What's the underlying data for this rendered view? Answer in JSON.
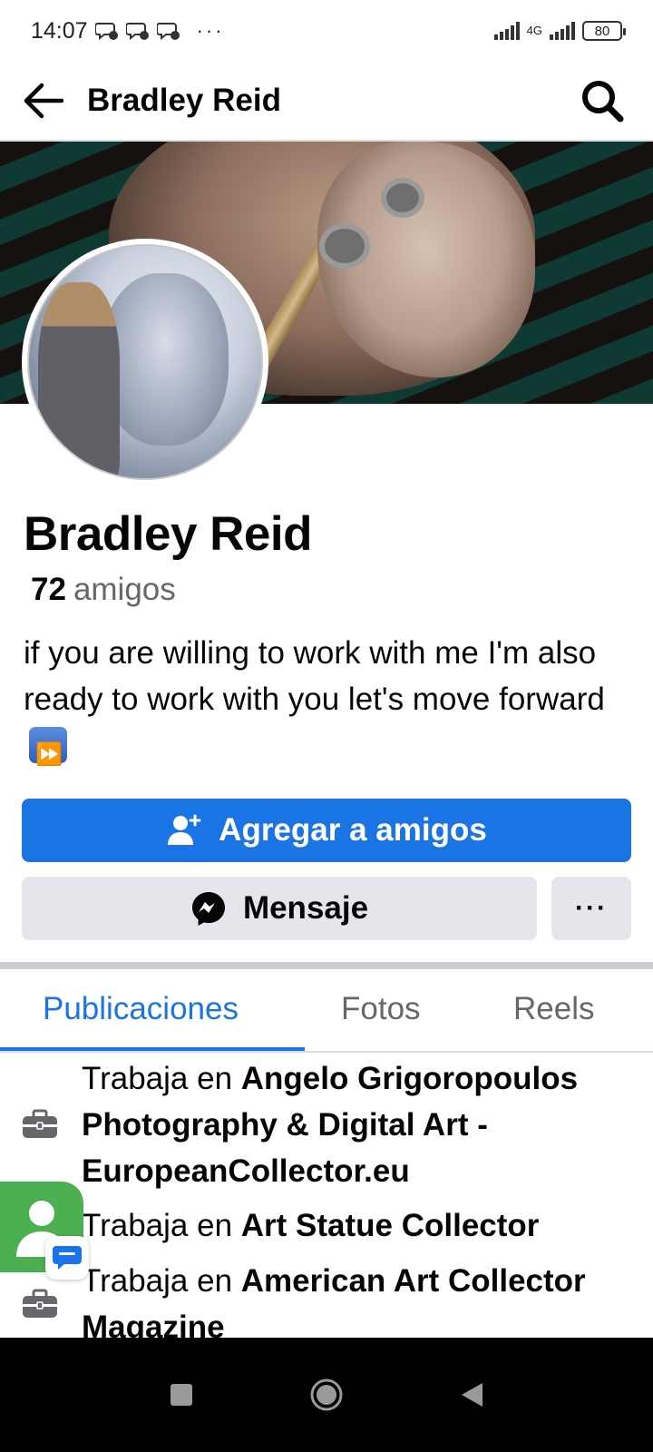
{
  "status_bar": {
    "time": "14:07",
    "more": "···",
    "network": "4G",
    "battery": "80"
  },
  "header": {
    "title": "Bradley Reid"
  },
  "profile": {
    "name": "Bradley Reid",
    "friends_count": "72",
    "friends_label": "amigos",
    "bio": "if you are willing to work with me I'm also ready to work with you let's move forward"
  },
  "actions": {
    "add_friend_label": "Agregar a amigos",
    "message_label": "Mensaje",
    "more_label": "···"
  },
  "tabs": [
    {
      "label": "Publicaciones",
      "active": true
    },
    {
      "label": "Fotos",
      "active": false
    },
    {
      "label": "Reels",
      "active": false
    }
  ],
  "work": [
    {
      "prefix": "Trabaja en ",
      "company": "Angelo Grigoropoulos Photography & Digital Art - EuropeanCollector.eu"
    },
    {
      "prefix": "Trabaja en ",
      "company": "Art Statue Collector"
    },
    {
      "prefix": "Trabaja en ",
      "company": "American Art Collector Magazine"
    }
  ],
  "colors": {
    "accent": "#1b74e4",
    "secondary_button": "#e4e6eb",
    "muted_text": "#65676b"
  }
}
